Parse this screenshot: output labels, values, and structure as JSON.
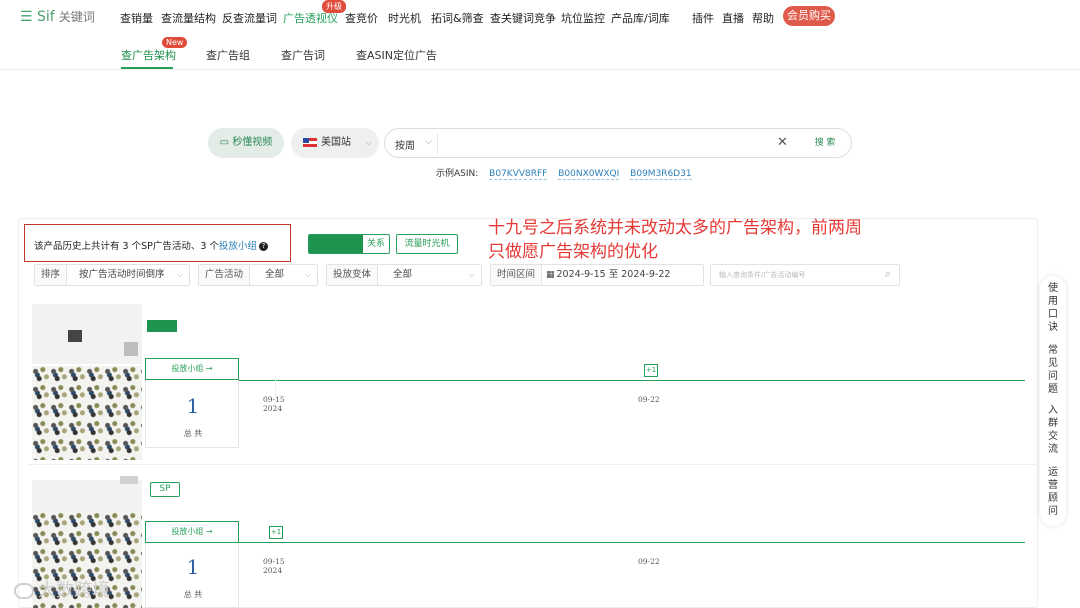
{
  "topnav": {
    "logo": "Sif",
    "logo_sub": "关键词",
    "items": [
      "查销量",
      "查流量结构",
      "反查流量词",
      "广告透视仪",
      "查竞价",
      "时光机",
      "拓词&筛查",
      "查关键词竞争",
      "坑位监控",
      "产品库/词库",
      "插件",
      "直播",
      "帮助"
    ],
    "upgrade_badge": "升级",
    "member_button": "会员购买"
  },
  "subtabs": {
    "items": [
      "查广告架构",
      "查广告组",
      "查广告词",
      "查ASIN定位广告"
    ],
    "new_badge": "New"
  },
  "search": {
    "video_button": "秒懂视频",
    "site": "美国站",
    "mode": "按周",
    "search_button": "搜 索",
    "examples_label": "示例ASIN:",
    "examples": [
      "B07KVV8RFF",
      "B00NX0WXQI",
      "B09M3R6D31"
    ]
  },
  "info": {
    "text_prefix": "该产品历史上共计有 3 个SP广告活动、3 个",
    "link": "投放小组",
    "toggle_label": "关系",
    "time_machine": "流量时光机"
  },
  "annotation": "十九号之后系统并未改动太多的广告架构，前两周只做愿广告架构的优化",
  "filters": {
    "sort_label": "排序",
    "sort_value": "按广告活动时间倒序",
    "campaign_label": "广告活动",
    "campaign_value": "全部",
    "variant_label": "投放变体",
    "variant_value": "全部",
    "range_label": "时间区间",
    "range_start": "2024-9-15",
    "range_to": "至",
    "range_end": "2024-9-22",
    "search_placeholder": "输入查询条件/广告活动编号"
  },
  "float_sidebar": [
    "使用口诀",
    "常见问题",
    "入群交流",
    "运营顾问"
  ],
  "rows": [
    {
      "group_button": "投放小组 →",
      "count": "1",
      "count_label": "总 共",
      "plus": "+1",
      "date1": "09-15",
      "year1": "2024",
      "date2": "09-22"
    },
    {
      "badge": "SP",
      "group_button": "投放小组 →",
      "count": "1",
      "count_label": "总 共",
      "plus": "+1",
      "date1": "09-15",
      "year1": "2024",
      "date2": "09-22"
    }
  ],
  "watermark": "大数跨境",
  "colors": {
    "accent": "#27a05a",
    "annotation": "#e53935",
    "link": "#2c7fb8",
    "badge": "#e04b3a"
  }
}
